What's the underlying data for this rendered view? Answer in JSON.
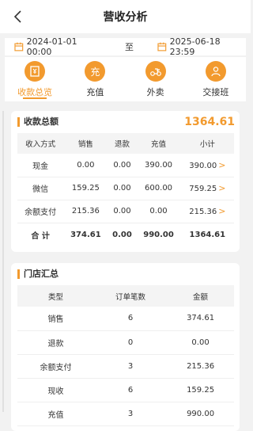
{
  "header": {
    "title": "营收分析"
  },
  "date_range": {
    "start": "2024-01-01 00:00",
    "separator": "至",
    "end": "2025-06-18 23:59"
  },
  "tabs": [
    {
      "label": "收款总览",
      "icon": "receipt-icon",
      "glyph": ""
    },
    {
      "label": "充值",
      "icon": "recharge-icon",
      "glyph": "充"
    },
    {
      "label": "外卖",
      "icon": "delivery-icon",
      "glyph": ""
    },
    {
      "label": "交接班",
      "icon": "handover-icon",
      "glyph": ""
    }
  ],
  "summary": {
    "title": "收款总额",
    "total": "1364.61",
    "columns": [
      "收入方式",
      "销售",
      "退款",
      "充值",
      "小计"
    ],
    "rows": [
      {
        "method": "现金",
        "sales": "0.00",
        "refund": "0.00",
        "recharge": "390.00",
        "subtotal": "390.00"
      },
      {
        "method": "微信",
        "sales": "159.25",
        "refund": "0.00",
        "recharge": "600.00",
        "subtotal": "759.25"
      },
      {
        "method": "余额支付",
        "sales": "215.36",
        "refund": "0.00",
        "recharge": "0.00",
        "subtotal": "215.36"
      }
    ],
    "sum_row": {
      "label": "合 计",
      "sales": "374.61",
      "refund": "0.00",
      "recharge": "990.00",
      "subtotal": "1364.61"
    }
  },
  "stores": {
    "title": "门店汇总",
    "columns": [
      "类型",
      "订单笔数",
      "金额"
    ],
    "rows": [
      {
        "type": "销售",
        "count": "6",
        "amount": "374.61"
      },
      {
        "type": "退款",
        "count": "0",
        "amount": "0.00"
      },
      {
        "type": "余额支付",
        "count": "3",
        "amount": "215.36"
      },
      {
        "type": "现收",
        "count": "6",
        "amount": "159.25"
      },
      {
        "type": "充值",
        "count": "3",
        "amount": "990.00"
      }
    ]
  },
  "colors": {
    "accent": "#f29a2e",
    "background": "#f2f2f2"
  }
}
